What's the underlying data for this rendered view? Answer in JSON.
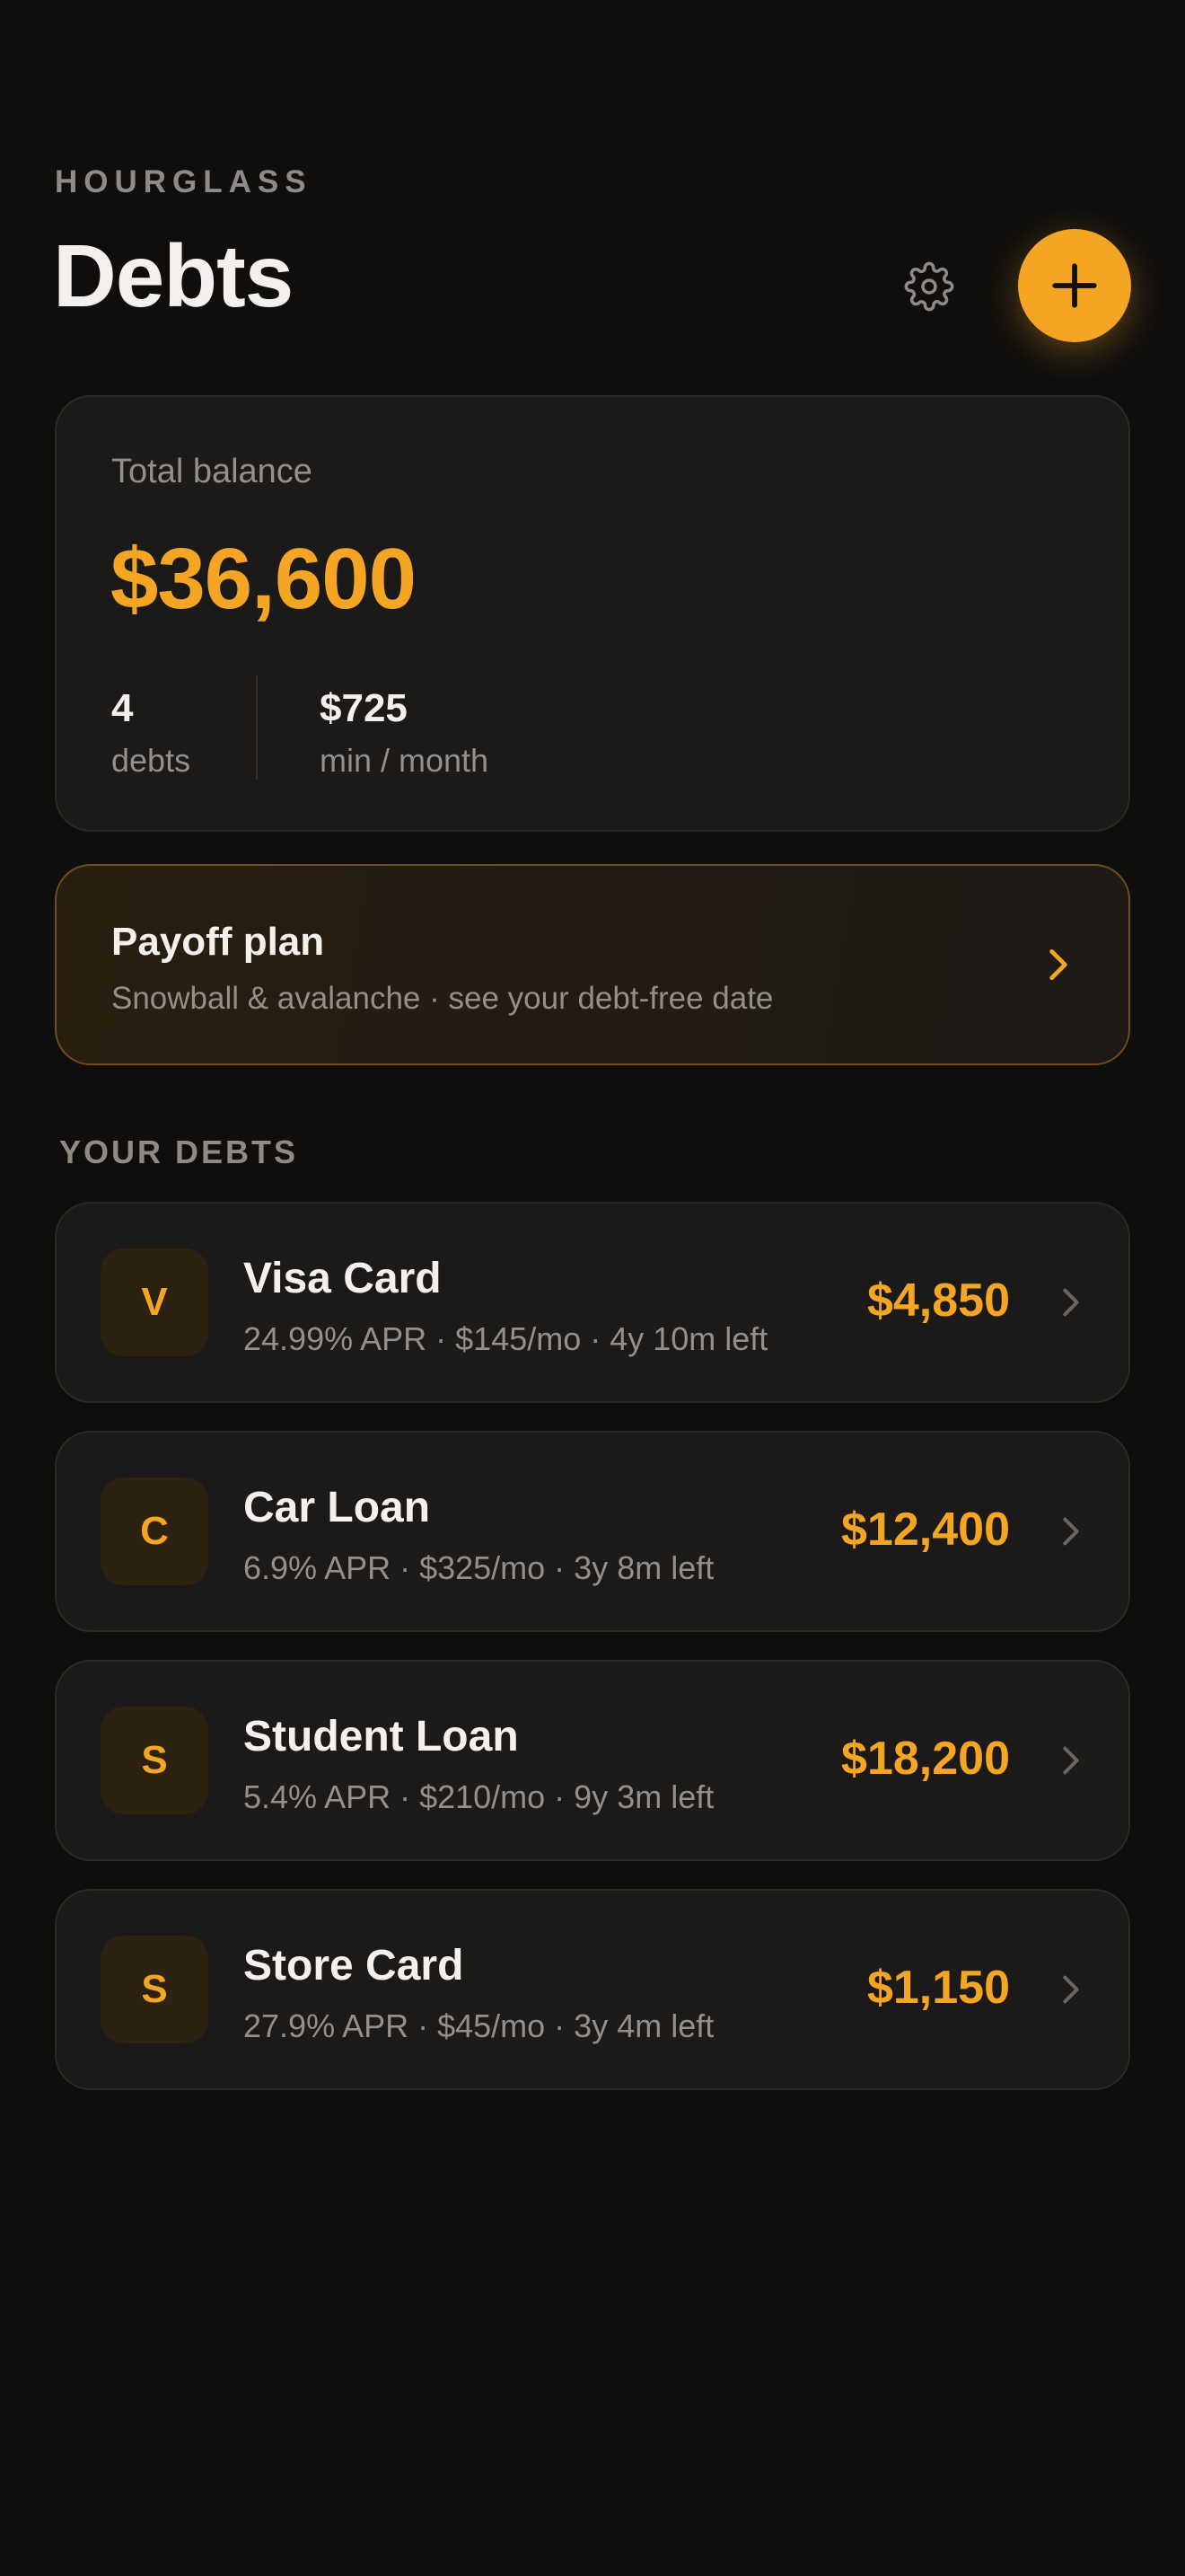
{
  "header": {
    "brand": "HOURGLASS",
    "title": "Debts",
    "settings_icon": "gear-icon",
    "add_icon": "plus-icon"
  },
  "summary": {
    "label": "Total balance",
    "amount": "$36,600",
    "stats": [
      {
        "value": "4",
        "label": "debts"
      },
      {
        "value": "$725",
        "label": "min / month"
      }
    ]
  },
  "plan": {
    "title": "Payoff plan",
    "subtitle": "Snowball & avalanche · see your debt-free date",
    "chevron_icon": "chevron-right-icon"
  },
  "debts_section": {
    "label": "YOUR DEBTS",
    "items": [
      {
        "initial": "V",
        "name": "Visa Card",
        "meta": "24.99% APR · $145/mo · 4y 10m left",
        "amount": "$4,850"
      },
      {
        "initial": "C",
        "name": "Car Loan",
        "meta": "6.9% APR · $325/mo · 3y 8m left",
        "amount": "$12,400"
      },
      {
        "initial": "S",
        "name": "Student Loan",
        "meta": "5.4% APR · $210/mo · 9y 3m left",
        "amount": "$18,200"
      },
      {
        "initial": "S",
        "name": "Store Card",
        "meta": "27.9% APR · $45/mo · 3y 4m left",
        "amount": "$1,150"
      }
    ]
  },
  "colors": {
    "accent": "#f5a524",
    "background": "#0f0e0d",
    "card": "#1c1a18",
    "muted_text": "#948f88"
  }
}
